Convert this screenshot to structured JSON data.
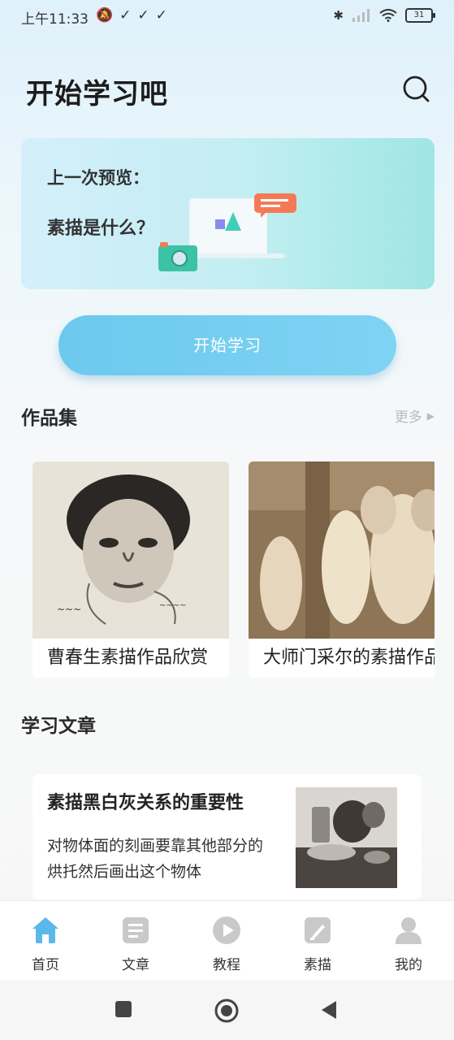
{
  "status_bar": {
    "time": "上午11:33",
    "battery": "31"
  },
  "header": {
    "title": "开始学习吧",
    "search_icon": "search-icon"
  },
  "preview": {
    "label": "上一次预览：",
    "topic": "素描是什么？"
  },
  "start_button": "开始学习",
  "gallery": {
    "title": "作品集",
    "more_label": "更多",
    "items": [
      {
        "caption": "曹春生素描作品欣赏"
      },
      {
        "caption": "大师门采尔的素描作品"
      }
    ]
  },
  "articles": {
    "title": "学习文章",
    "items": [
      {
        "title": "素描黑白灰关系的重要性",
        "summary": "对物体面的刻画要靠其他部分的烘托然后画出这个物体"
      }
    ]
  },
  "bottom_nav": [
    {
      "label": "首页",
      "icon": "home-icon",
      "active": true
    },
    {
      "label": "文章",
      "icon": "article-icon",
      "active": false
    },
    {
      "label": "教程",
      "icon": "play-icon",
      "active": false
    },
    {
      "label": "素描",
      "icon": "sketch-icon",
      "active": false
    },
    {
      "label": "我的",
      "icon": "profile-icon",
      "active": false
    }
  ],
  "colors": {
    "accent": "#6cc9ee",
    "nav_active": "#5bb8ea",
    "nav_inactive": "#c9c9c9"
  }
}
